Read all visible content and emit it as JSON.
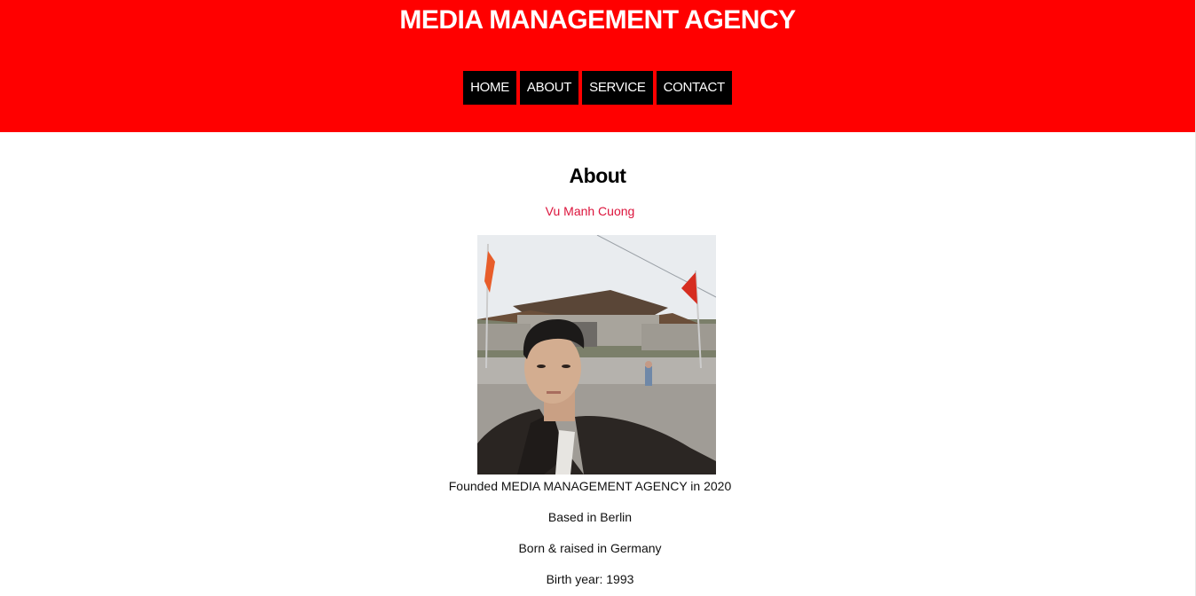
{
  "header": {
    "title": "MEDIA MANAGEMENT AGENCY",
    "nav": [
      {
        "label": "HOME"
      },
      {
        "label": "ABOUT"
      },
      {
        "label": "SERVICE"
      },
      {
        "label": "CONTACT"
      }
    ]
  },
  "main": {
    "heading": "About",
    "author": "Vu Manh Cuong",
    "photo_alt": "Portrait photo in front of a temple with flags",
    "facts": [
      "Founded MEDIA MANAGEMENT AGENCY in 2020",
      "Based in Berlin",
      "Born & raised in Germany",
      "Birth year: 1993"
    ]
  },
  "colors": {
    "header_bg": "#ff0000",
    "nav_bg": "#000000",
    "author": "#dc143c"
  }
}
